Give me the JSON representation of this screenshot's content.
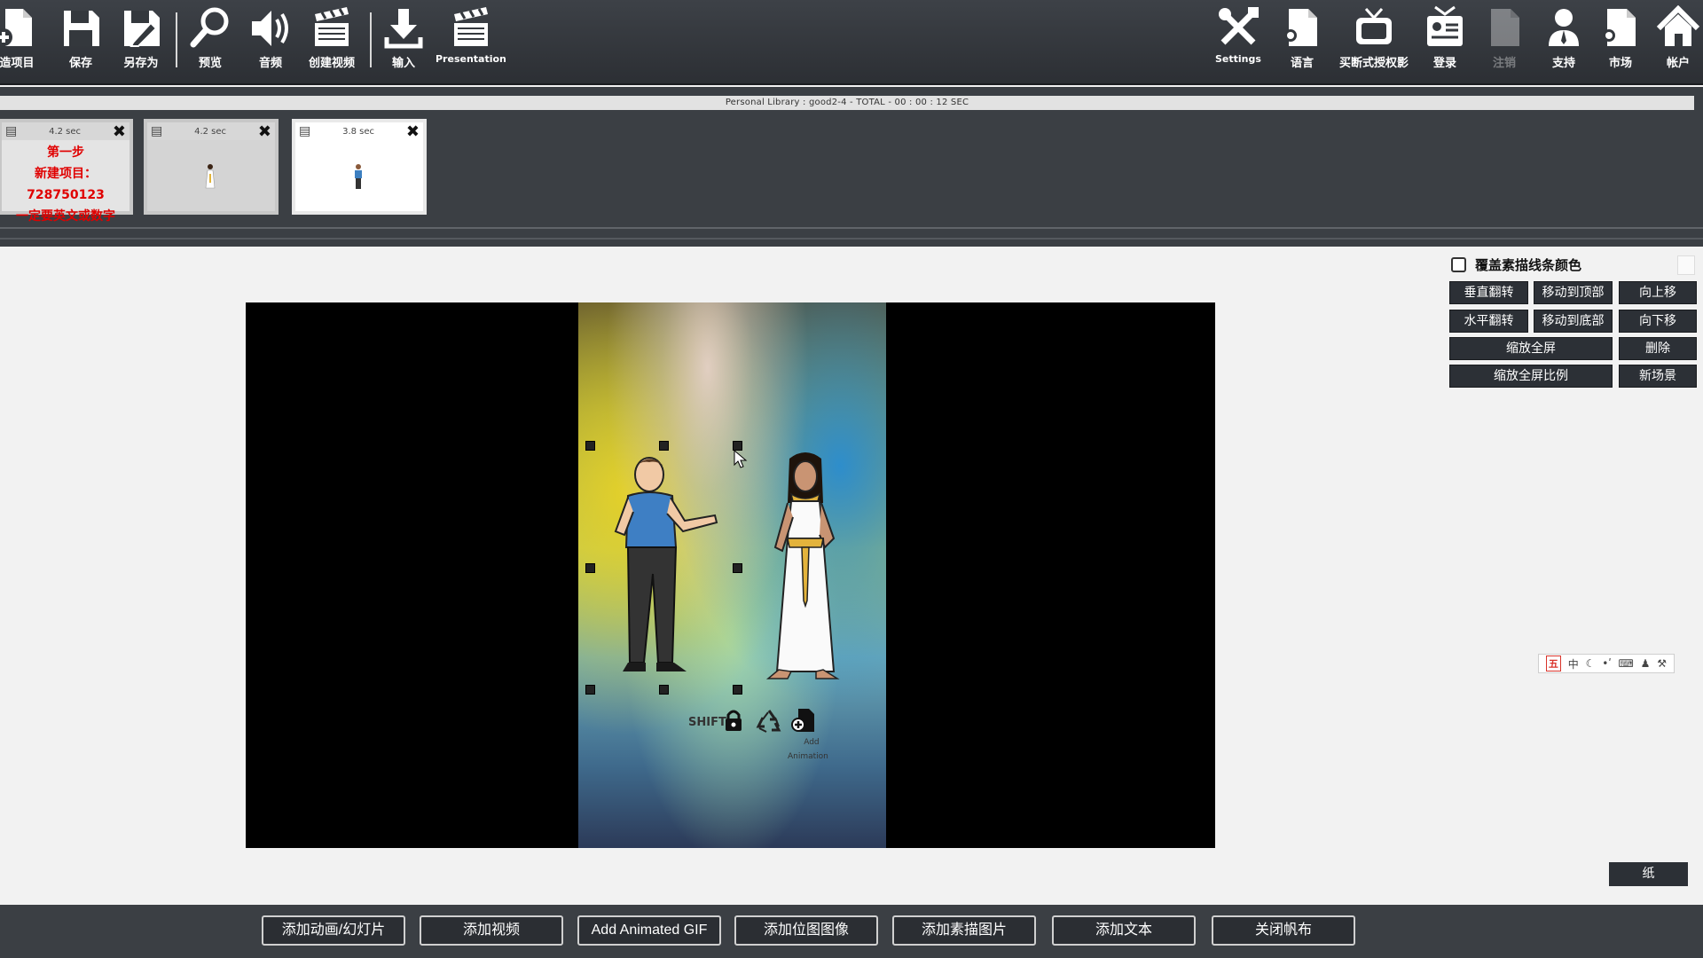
{
  "toolbar": {
    "left_items": [
      {
        "label": "造项目",
        "icon": "new-document-icon"
      },
      {
        "label": "保存",
        "icon": "save-icon"
      },
      {
        "label": "另存为",
        "icon": "save-as-icon"
      },
      {
        "label": "预览",
        "icon": "magnifier-icon"
      },
      {
        "label": "音频",
        "icon": "speaker-icon"
      },
      {
        "label": "创建视频",
        "icon": "clapperboard-icon"
      },
      {
        "label": "输入",
        "icon": "import-arrow-icon"
      },
      {
        "label": "Presentation",
        "icon": "clapperboard-icon"
      }
    ],
    "right_items": [
      {
        "label": "Settings",
        "icon": "tools-icon",
        "enabled": true
      },
      {
        "label": "语言",
        "icon": "language-document-icon",
        "enabled": true
      },
      {
        "label": "买断式授权影",
        "icon": "tv-icon",
        "enabled": true
      },
      {
        "label": "登录",
        "icon": "id-card-icon",
        "enabled": true
      },
      {
        "label": "注销",
        "icon": "logout-document-icon",
        "enabled": false
      },
      {
        "label": "支持",
        "icon": "support-person-icon",
        "enabled": true
      },
      {
        "label": "市场",
        "icon": "market-document-icon",
        "enabled": true
      },
      {
        "label": "帐户",
        "icon": "home-icon",
        "enabled": true
      }
    ]
  },
  "library_bar": "Personal Library : good2-4  -  TOTAL -  00 : 00 : 12 SEC",
  "slides": [
    {
      "duration": "4.2 sec",
      "text_lines": [
        "第一步",
        "新建项目：728750123",
        "一定要英文或数字"
      ]
    },
    {
      "duration": "4.2 sec"
    },
    {
      "duration": "3.8 sec"
    }
  ],
  "canvas": {
    "shift_label": "SHIFT",
    "add_animation_label_1": "Add",
    "add_animation_label_2": "Animation"
  },
  "properties": {
    "override_checkbox_label": "覆盖素描线条颜色",
    "override_checked": false,
    "buttons": {
      "flip_vertical": "垂直翻转",
      "move_to_top": "移动到顶部",
      "move_up": "向上移",
      "flip_horizontal": "水平翻转",
      "move_to_bottom": "移动到底部",
      "move_down": "向下移",
      "zoom_fullscreen": "缩放全屏",
      "delete": "删除",
      "zoom_fullscreen_ratio": "缩放全屏比例",
      "new_scene": "新场景"
    },
    "ime_bar": {
      "wu": "五",
      "zh": "中"
    },
    "paper_button": "纸"
  },
  "bottom_bar": [
    "添加动画/幻灯片",
    "添加视频",
    "Add Animated GIF",
    "添加位图图像",
    "添加素描图片",
    "添加文本",
    "关闭帆布"
  ],
  "colors": {
    "toolbar_bg": "#34383d",
    "button_bg": "#2c3036",
    "slide_text_red": "#e00000"
  }
}
